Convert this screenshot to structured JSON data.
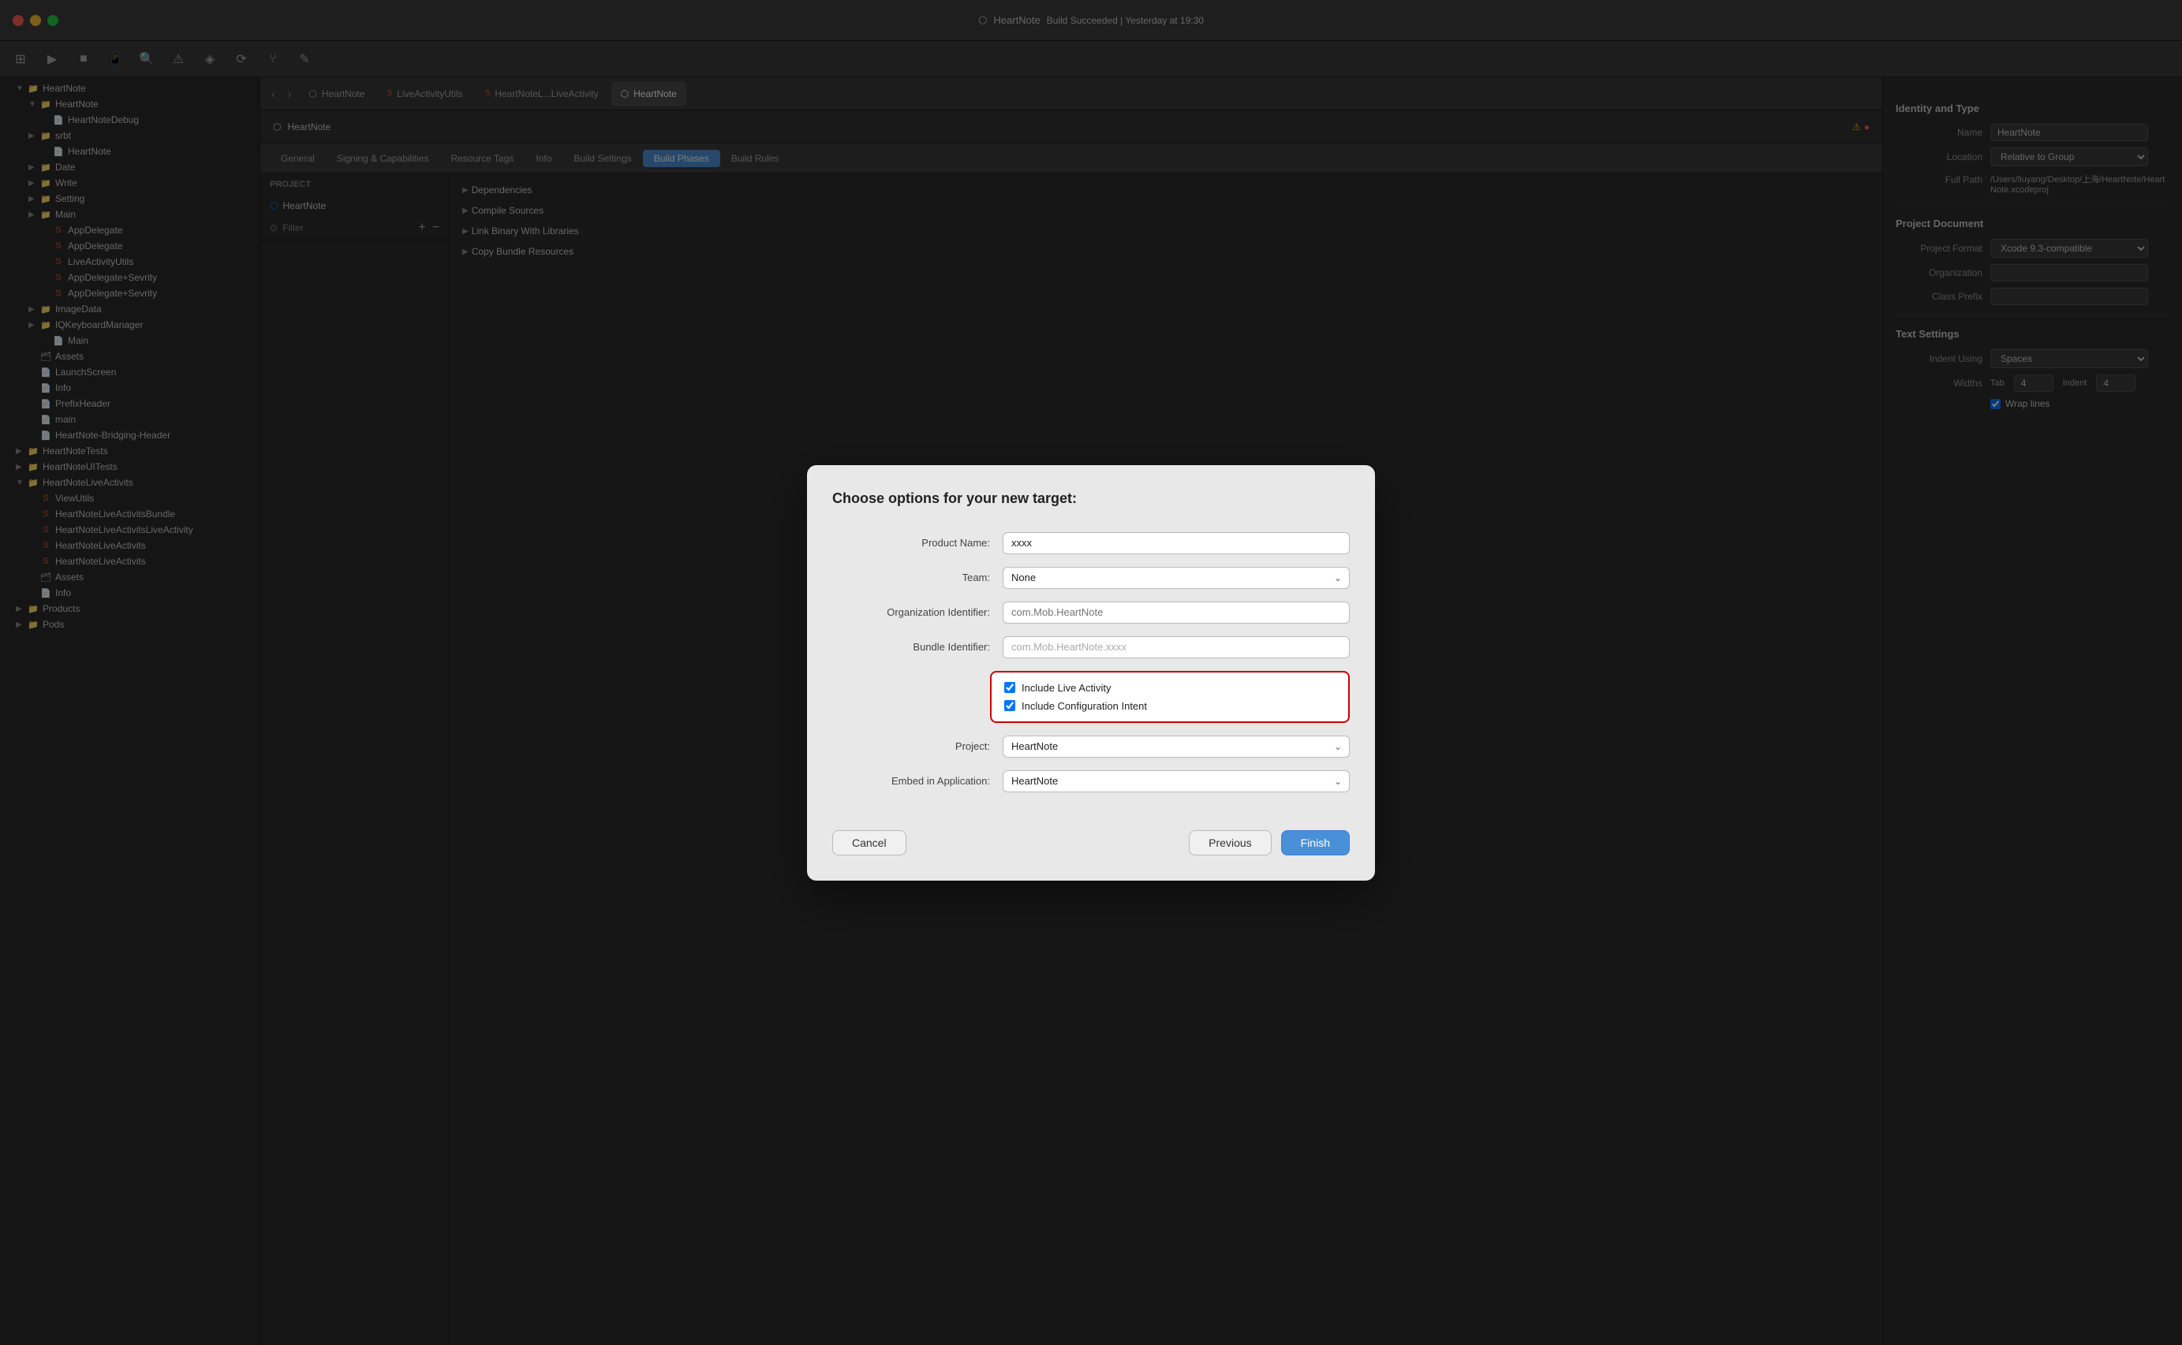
{
  "app": {
    "title": "HeartNote",
    "build_status": "Build Succeeded | Yesterday at 19:30"
  },
  "titlebar": {
    "traffic_lights": [
      "red",
      "yellow",
      "green"
    ],
    "title": "HeartNote",
    "build_info": "Build Succeeded | Yesterday at 19:30"
  },
  "tabs": [
    {
      "label": "HeartNote",
      "active": false
    },
    {
      "label": "LiveActivityUtils",
      "active": false
    },
    {
      "label": "HeartNoteL...LiveActivity",
      "active": false
    },
    {
      "label": "HeartNote",
      "active": true
    }
  ],
  "xcode_tabs": [
    {
      "label": "General",
      "active": false
    },
    {
      "label": "Signing & Capabilities",
      "active": false
    },
    {
      "label": "Resource Tags",
      "active": false
    },
    {
      "label": "Info",
      "active": false
    },
    {
      "label": "Build Settings",
      "active": false
    },
    {
      "label": "Build Phases",
      "active": true
    },
    {
      "label": "Build Rules",
      "active": false
    }
  ],
  "sidebar": {
    "root_group": "HeartNote",
    "items": [
      {
        "label": "HeartNote",
        "level": 1,
        "type": "group",
        "expanded": true
      },
      {
        "label": "HeartNoteDebug",
        "level": 2,
        "type": "file"
      },
      {
        "label": "srbt",
        "level": 2,
        "type": "group",
        "expanded": false
      },
      {
        "label": "HeartNote",
        "level": 2,
        "type": "file"
      },
      {
        "label": "Date",
        "level": 2,
        "type": "group",
        "expanded": false
      },
      {
        "label": "Write",
        "level": 2,
        "type": "group",
        "expanded": false
      },
      {
        "label": "Setting",
        "level": 2,
        "type": "group",
        "expanded": false
      },
      {
        "label": "Main",
        "level": 2,
        "type": "group",
        "expanded": false
      },
      {
        "label": "AppDelegate",
        "level": 3,
        "type": "swift"
      },
      {
        "label": "AppDelegate",
        "level": 3,
        "type": "swift"
      },
      {
        "label": "LiveActivityUtils",
        "level": 3,
        "type": "swift"
      },
      {
        "label": "AppDelegate+Sevrity",
        "level": 3,
        "type": "swift"
      },
      {
        "label": "AppDelegate+Sevrity",
        "level": 3,
        "type": "swift"
      },
      {
        "label": "ImageData",
        "level": 2,
        "type": "group",
        "expanded": false
      },
      {
        "label": "IQKeyboardManager",
        "level": 2,
        "type": "group",
        "expanded": false
      },
      {
        "label": "Main",
        "level": 3,
        "type": "file"
      },
      {
        "label": "Assets",
        "level": 2,
        "type": "assets"
      },
      {
        "label": "LaunchScreen",
        "level": 2,
        "type": "file"
      },
      {
        "label": "Info",
        "level": 2,
        "type": "file"
      },
      {
        "label": "PrefixHeader",
        "level": 2,
        "type": "file"
      },
      {
        "label": "main",
        "level": 2,
        "type": "file"
      },
      {
        "label": "HeartNote-Bridging-Header",
        "level": 2,
        "type": "file"
      },
      {
        "label": "HeartNoteTests",
        "level": 1,
        "type": "group",
        "expanded": false
      },
      {
        "label": "HeartNoteUITests",
        "level": 1,
        "type": "group",
        "expanded": false
      },
      {
        "label": "HeartNoteLiveActivits",
        "level": 1,
        "type": "group",
        "expanded": true
      },
      {
        "label": "ViewUtils",
        "level": 2,
        "type": "swift"
      },
      {
        "label": "HeartNoteLiveActivitsBundle",
        "level": 2,
        "type": "swift"
      },
      {
        "label": "HeartNoteLiveActivitsLiveActivity",
        "level": 2,
        "type": "swift"
      },
      {
        "label": "HeartNoteLiveActivits",
        "level": 2,
        "type": "swift"
      },
      {
        "label": "HeartNoteLiveActivits",
        "level": 2,
        "type": "swift"
      },
      {
        "label": "Assets",
        "level": 2,
        "type": "assets"
      },
      {
        "label": "Info",
        "level": 2,
        "type": "file"
      },
      {
        "label": "Products",
        "level": 1,
        "type": "group",
        "expanded": false
      },
      {
        "label": "Pods",
        "level": 1,
        "type": "group",
        "expanded": false
      }
    ]
  },
  "editor": {
    "filename": "HeartNote",
    "project_label": "PROJECT",
    "project_name": "HeartNote"
  },
  "build_phases": {
    "filter_placeholder": "Filter",
    "add_btn": "+",
    "phases": [
      "Dependencies",
      "Compile Sources",
      "Link Binary With Libraries",
      "Copy Bundle Resources"
    ]
  },
  "right_panel": {
    "identity_title": "Identity and Type",
    "name_label": "Name",
    "name_value": "HeartNote",
    "location_label": "Location",
    "location_value": "Relative to Group",
    "full_path_label": "Full Path",
    "full_path_value": "/Users/liuyang/Desktop/上海/HeartNote/HeartNote.xcodeproj",
    "project_doc_title": "Project Document",
    "project_format_label": "Project Format",
    "project_format_value": "Xcode 9.3-compatible",
    "org_label": "Organization",
    "org_value": "",
    "class_prefix_label": "Class Prefix",
    "class_prefix_value": "",
    "text_settings_title": "Text Settings",
    "indent_using_label": "Indent Using",
    "indent_using_value": "Spaces",
    "widths_label": "Widths",
    "tab_label": "Tab",
    "tab_value": "4",
    "indent_label": "Indent",
    "indent_value": "4",
    "wrap_lines_label": "Wrap lines",
    "wrap_lines_checked": true
  },
  "modal": {
    "title": "Choose options for your new target:",
    "product_name_label": "Product Name:",
    "product_name_value": "xxxx",
    "team_label": "Team:",
    "team_value": "None",
    "org_identifier_label": "Organization Identifier:",
    "org_identifier_placeholder": "com.Mob.HeartNote",
    "bundle_identifier_label": "Bundle Identifier:",
    "bundle_identifier_value": "com.Mob.HeartNote.xxxx",
    "include_live_activity_label": "Include Live Activity",
    "include_live_activity_checked": true,
    "include_config_intent_label": "Include Configuration Intent",
    "include_config_intent_checked": true,
    "project_label": "Project:",
    "project_value": "HeartNote",
    "embed_label": "Embed in Application:",
    "embed_value": "HeartNote",
    "cancel_btn": "Cancel",
    "previous_btn": "Previous",
    "finish_btn": "Finish"
  }
}
